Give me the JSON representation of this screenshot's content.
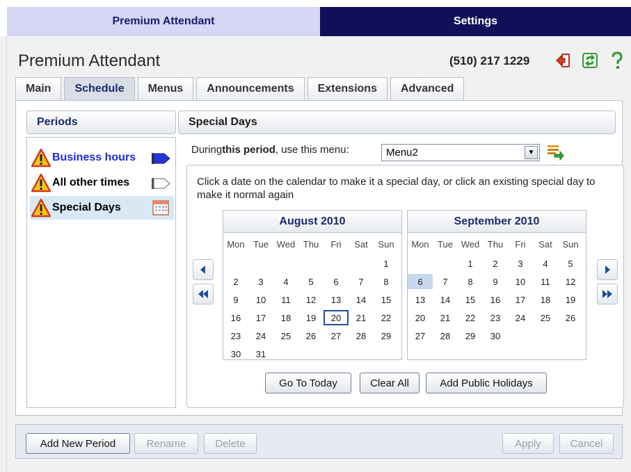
{
  "top_tabs": [
    {
      "label": "Premium Attendant",
      "active": true
    },
    {
      "label": "Settings",
      "active": false
    }
  ],
  "header": {
    "title": "Premium Attendant",
    "phone": "(510) 217 1229",
    "icons": [
      "logout-icon",
      "refresh-icon",
      "help-icon"
    ]
  },
  "sub_tabs": [
    {
      "label": "Main"
    },
    {
      "label": "Schedule",
      "active": true
    },
    {
      "label": "Menus"
    },
    {
      "label": "Announcements"
    },
    {
      "label": "Extensions"
    },
    {
      "label": "Advanced"
    }
  ],
  "periods": {
    "header": "Periods",
    "items": [
      {
        "label": "Business hours",
        "icon": "blue-flag-icon",
        "color": "#1e2bd6"
      },
      {
        "label": "All other times",
        "icon": "white-flag-icon",
        "color": "#111111"
      },
      {
        "label": "Special Days",
        "icon": "calendar-icon",
        "color": "#111111",
        "selected": true
      }
    ]
  },
  "special_days": {
    "header": "Special Days",
    "menu_prefix": "During ",
    "menu_bold": "this period",
    "menu_suffix": ", use this menu:",
    "menu_value": "Menu2",
    "instructions": "Click a date on the calendar to make it a special day, or click an existing special day to make it normal again"
  },
  "calendars": [
    {
      "title": "August 2010",
      "weekdays": [
        "Mon",
        "Tue",
        "Wed",
        "Thu",
        "Fri",
        "Sat",
        "Sun"
      ],
      "weeks": [
        [
          "",
          "",
          "",
          "",
          "",
          "",
          "1"
        ],
        [
          "2",
          "3",
          "4",
          "5",
          "6",
          "7",
          "8"
        ],
        [
          "9",
          "10",
          "11",
          "12",
          "13",
          "14",
          "15"
        ],
        [
          "16",
          "17",
          "18",
          "19",
          "20",
          "21",
          "22"
        ],
        [
          "23",
          "24",
          "25",
          "26",
          "27",
          "28",
          "29"
        ],
        [
          "30",
          "31",
          "",
          "",
          "",
          "",
          ""
        ]
      ],
      "today": "20"
    },
    {
      "title": "September 2010",
      "weekdays": [
        "Mon",
        "Tue",
        "Wed",
        "Thu",
        "Fri",
        "Sat",
        "Sun"
      ],
      "weeks": [
        [
          "",
          "",
          "1",
          "2",
          "3",
          "4",
          "5"
        ],
        [
          "6",
          "7",
          "8",
          "9",
          "10",
          "11",
          "12"
        ],
        [
          "13",
          "14",
          "15",
          "16",
          "17",
          "18",
          "19"
        ],
        [
          "20",
          "21",
          "22",
          "23",
          "24",
          "25",
          "26"
        ],
        [
          "27",
          "28",
          "29",
          "30",
          "",
          "",
          ""
        ]
      ],
      "special": "6"
    }
  ],
  "calendar_buttons": {
    "go_to_today": "Go To Today",
    "clear_all": "Clear All",
    "add_public_holidays": "Add Public Holidays"
  },
  "footer": {
    "add_new_period": "Add New Period",
    "rename": "Rename",
    "delete": "Delete",
    "apply": "Apply",
    "cancel": "Cancel"
  },
  "colors": {
    "active_tab_bg": "#d6d6f5",
    "settings_tab_bg": "#10105a",
    "accent_blue": "#1d2b6d",
    "warning_yellow": "#f5c518",
    "warning_red": "#d23a1a"
  }
}
